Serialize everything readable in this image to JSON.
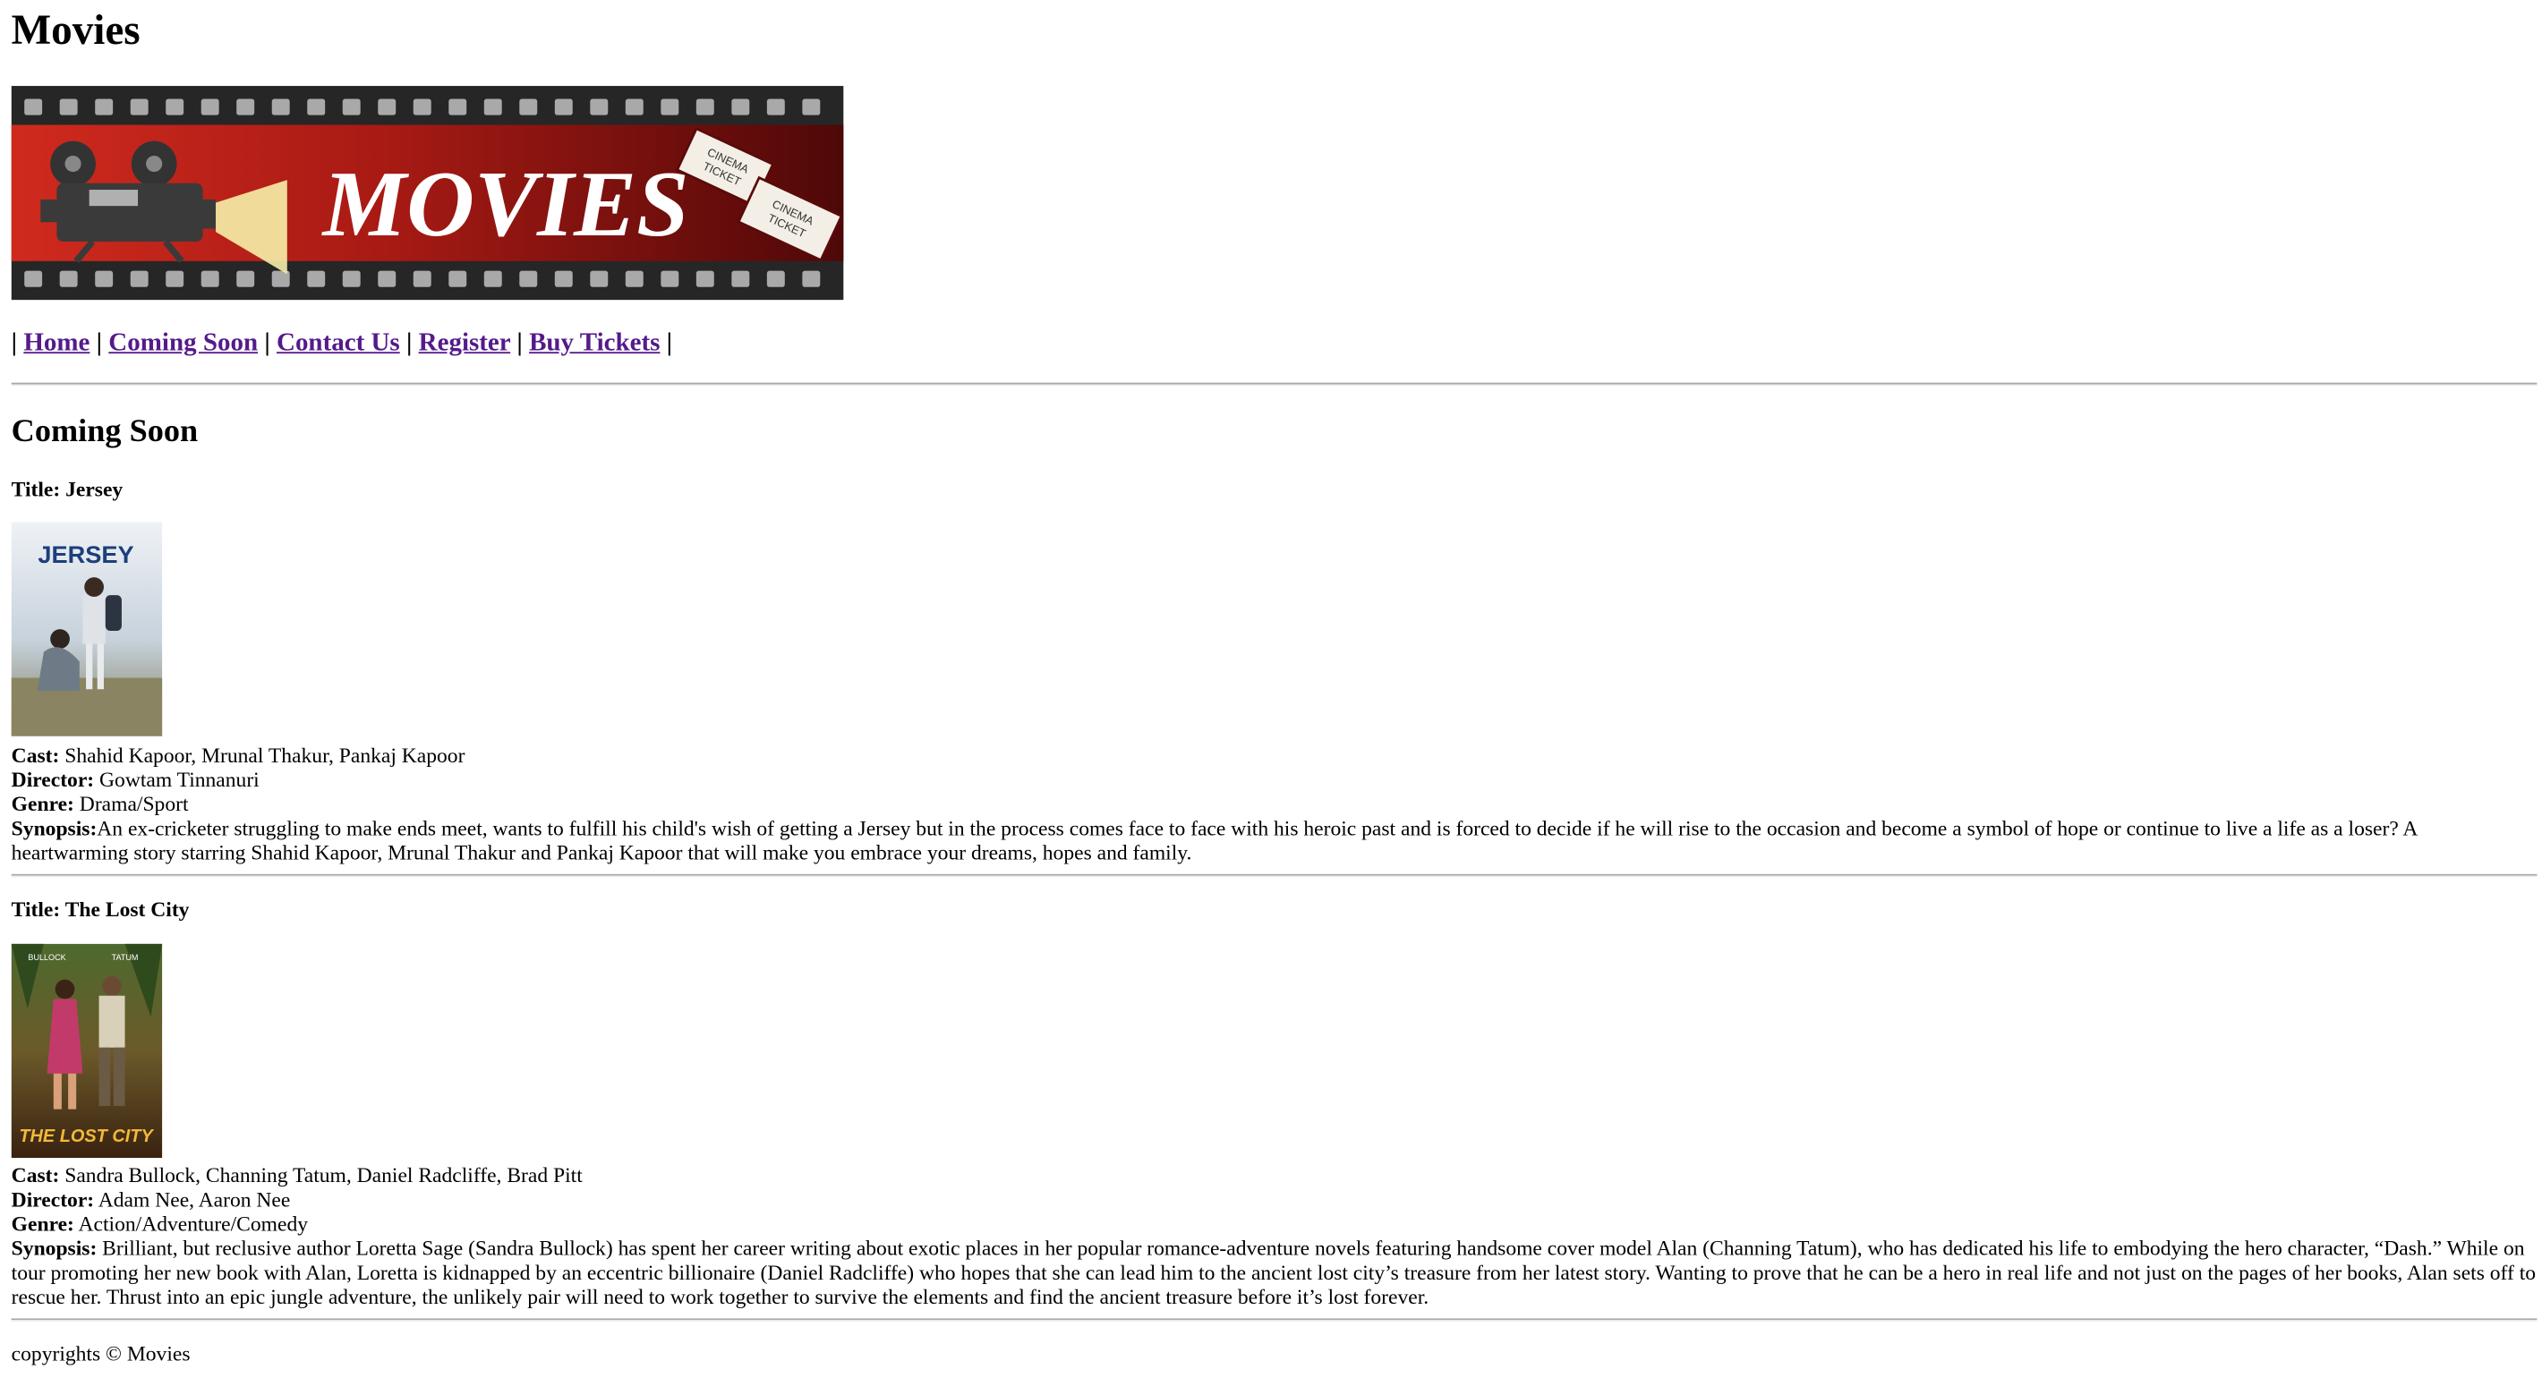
{
  "site": {
    "title": "Movies",
    "banner_text": "MOVIES",
    "ticket_text_1": "CINEMA",
    "ticket_text_2": "TICKET"
  },
  "nav": {
    "separator": "|",
    "items": [
      {
        "label": "Home"
      },
      {
        "label": "Coming Soon"
      },
      {
        "label": "Contact Us"
      },
      {
        "label": "Register"
      },
      {
        "label": "Buy Tickets"
      }
    ]
  },
  "section": {
    "title": "Coming Soon"
  },
  "labels": {
    "title": "Title: ",
    "cast": "Cast:",
    "director": "Director:",
    "genre": "Genre:",
    "synopsis": "Synopsis:"
  },
  "movies": [
    {
      "title": "Jersey",
      "poster_text": "JERSEY",
      "cast": "Shahid Kapoor, Mrunal Thakur, Pankaj Kapoor",
      "director": "Gowtam Tinnanuri",
      "genre": "Drama/Sport",
      "synopsis": "An ex-cricketer struggling to make ends meet, wants to fulfill his child's wish of getting a Jersey but in the process comes face to face with his heroic past and is forced to decide if he will rise to the occasion and become a symbol of hope or continue to live a life as a loser? A heartwarming story starring Shahid Kapoor, Mrunal Thakur and Pankaj Kapoor that will make you embrace your dreams, hopes and family."
    },
    {
      "title": "The Lost City",
      "poster_text": "THE LOST CITY",
      "poster_top_left": "BULLOCK",
      "poster_top_right": "TATUM",
      "cast": "Sandra Bullock, Channing Tatum, Daniel Radcliffe, Brad Pitt",
      "director": "Adam Nee, Aaron Nee",
      "genre": "Action/Adventure/Comedy",
      "synopsis": "Brilliant, but reclusive author Loretta Sage (Sandra Bullock) has spent her career writing about exotic places in her popular romance-adventure novels featuring handsome cover model Alan (Channing Tatum), who has dedicated his life to embodying the hero character, “Dash.” While on tour promoting her new book with Alan, Loretta is kidnapped by an eccentric billionaire (Daniel Radcliffe) who hopes that she can lead him to the ancient lost city’s treasure from her latest story. Wanting to prove that he can be a hero in real life and not just on the pages of her books, Alan sets off to rescue her. Thrust into an epic jungle adventure, the unlikely pair will need to work together to survive the elements and find the ancient treasure before it’s lost forever."
    }
  ],
  "footer": {
    "text": "copyrights © Movies"
  },
  "colors": {
    "link": "#551a8b",
    "banner_red": "#c9271d",
    "banner_dark": "#5a0a0a",
    "film_strip": "#2a2a2a"
  }
}
